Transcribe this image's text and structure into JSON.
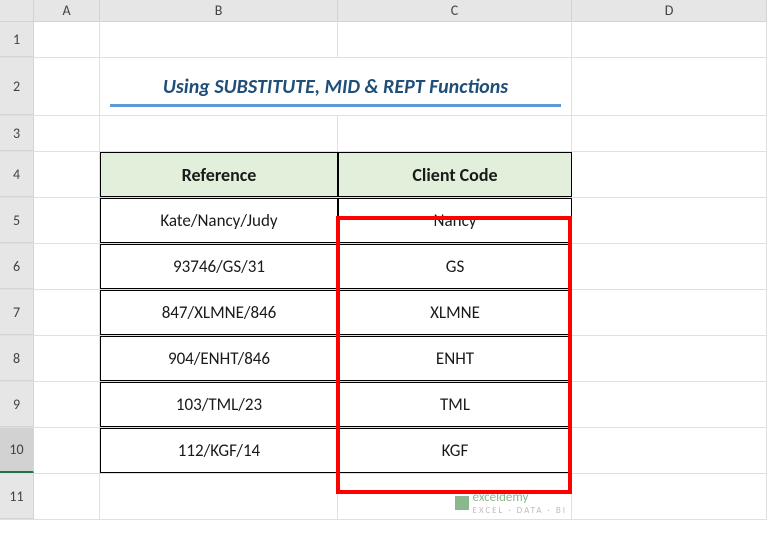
{
  "columns": {
    "A": "A",
    "B": "B",
    "C": "C",
    "D": "D"
  },
  "rows": {
    "r1": "1",
    "r2": "2",
    "r3": "3",
    "r4": "4",
    "r5": "5",
    "r6": "6",
    "r7": "7",
    "r8": "8",
    "r9": "9",
    "r10": "10",
    "r11": "11"
  },
  "title": "Using SUBSTITUTE, MID & REPT Functions",
  "headers": {
    "reference": "Reference",
    "client_code": "Client Code"
  },
  "data": [
    {
      "ref": "Kate/Nancy/Judy",
      "code": "Nancy"
    },
    {
      "ref": "93746/GS/31",
      "code": "GS"
    },
    {
      "ref": "847/XLMNE/846",
      "code": "XLMNE"
    },
    {
      "ref": "904/ENHT/846",
      "code": "ENHT"
    },
    {
      "ref": "103/TML/23",
      "code": "TML"
    },
    {
      "ref": "112/KGF/14",
      "code": "KGF"
    }
  ],
  "watermark": {
    "brand": "exceldemy",
    "sub": "EXCEL · DATA · BI"
  }
}
